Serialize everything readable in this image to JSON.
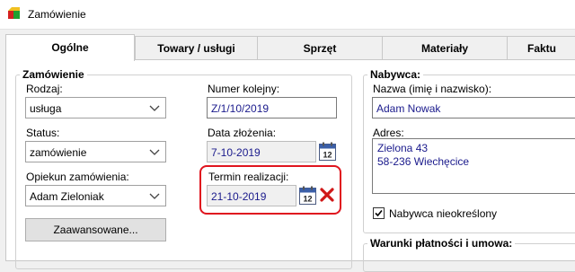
{
  "window": {
    "title": "Zamówienie"
  },
  "tabs": [
    "Ogólne",
    "Towary / usługi",
    "Sprzęt",
    "Materiały",
    "Faktu"
  ],
  "order": {
    "legend": "Zamówienie",
    "type_label": "Rodzaj:",
    "type_value": "usługa",
    "status_label": "Status:",
    "status_value": "zamówienie",
    "guardian_label": "Opiekun zamówienia:",
    "guardian_value": "Adam Zieloniak",
    "advanced_button": "Zaawansowane...",
    "number_label": "Numer kolejny:",
    "number_value": "Z/1/10/2019",
    "date_label": "Data złożenia:",
    "date_value": "7-10-2019",
    "deadline_label": "Termin realizacji:",
    "deadline_value": "21-10-2019",
    "calendar_day": "12"
  },
  "buyer": {
    "legend": "Nabywca:",
    "name_label": "Nazwa (imię i nazwisko):",
    "name_value": "Adam Nowak",
    "address_label": "Adres:",
    "address_line1": "Zielona 43",
    "address_line2": "58-236 Wiechęcice",
    "unknown_label": "Nabywca nieokreślony",
    "unknown_checked": true
  },
  "payment": {
    "legend": "Warunki płatności i umowa:"
  },
  "colors": {
    "highlight": "#e0141e",
    "value_text": "#1a1a8c"
  }
}
